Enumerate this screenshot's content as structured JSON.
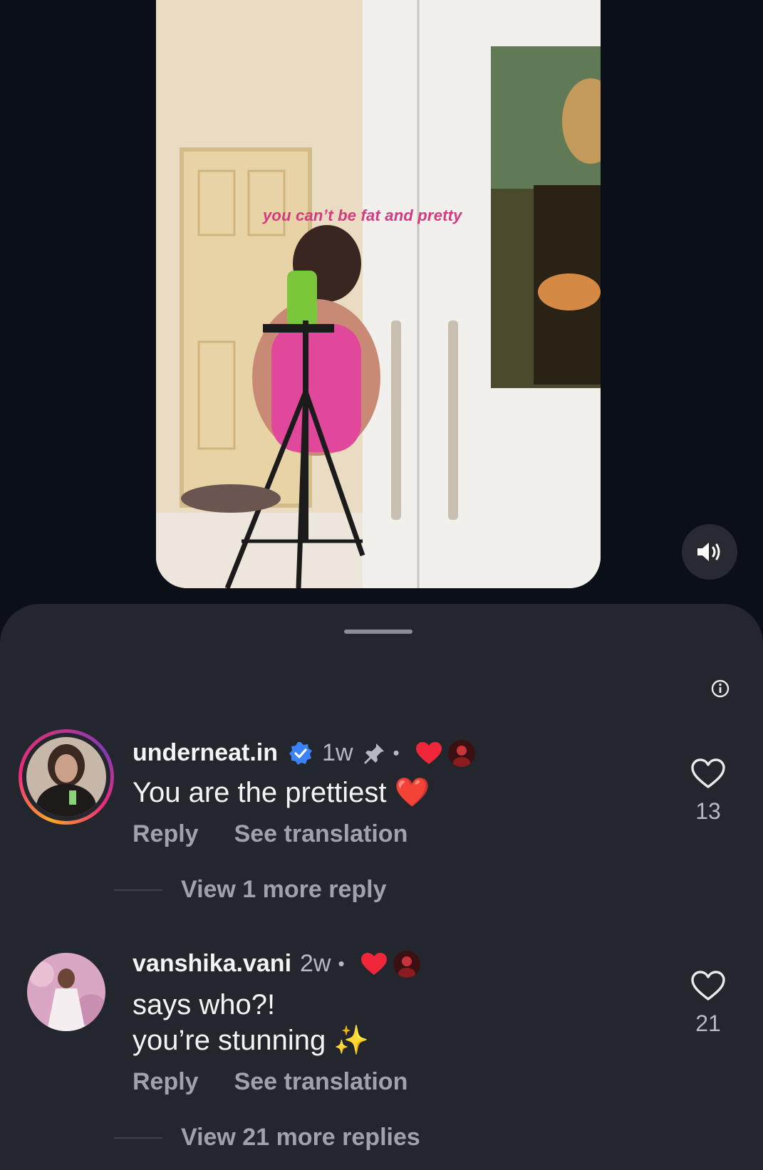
{
  "video": {
    "overlay_text": "you can’t be fat and pretty"
  },
  "comments": [
    {
      "username": "underneat.in",
      "verified": true,
      "time": "1w",
      "pinned": true,
      "liked_by_creator": true,
      "text": "You are the prettiest ❤️",
      "reply_label": "Reply",
      "translate_label": "See translation",
      "view_replies": "View 1 more reply",
      "likes": "13"
    },
    {
      "username": "vanshika.vani",
      "verified": false,
      "time": "2w",
      "pinned": false,
      "liked_by_creator": true,
      "text_line1": "says who?!",
      "text_line2": "you’re stunning ✨",
      "reply_label": "Reply",
      "translate_label": "See translation",
      "view_replies": "View 21 more replies",
      "likes": "21"
    }
  ],
  "colors": {
    "background": "#0b0f17",
    "sheet": "#24262d",
    "heart_red": "#f0263a",
    "verified_blue": "#3b82f6",
    "overlay_pink": "#d53a80"
  },
  "icons": [
    "sound-icon",
    "info-icon",
    "verified-icon",
    "pin-icon",
    "heart-icon",
    "like-heart-outline-icon"
  ]
}
